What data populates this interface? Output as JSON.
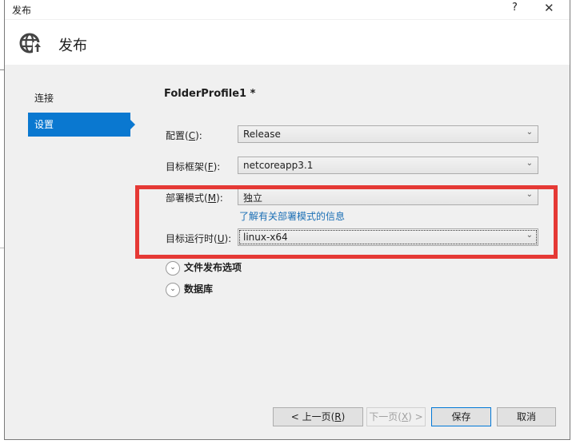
{
  "window": {
    "title": "发布",
    "help_label": "?",
    "close_label": "✕"
  },
  "header": {
    "icon": "globe-publish-icon",
    "title": "发布"
  },
  "nav": {
    "items": [
      {
        "label": "连接",
        "active": false
      },
      {
        "label": "设置",
        "active": true
      }
    ]
  },
  "main": {
    "profile_name": "FolderProfile1 *",
    "fields": {
      "configuration": {
        "label": "配置",
        "accel": "C",
        "value": "Release"
      },
      "target_framework": {
        "label": "目标框架",
        "accel": "F",
        "value": "netcoreapp3.1"
      },
      "deployment_mode": {
        "label": "部署模式",
        "accel": "M",
        "value": "独立"
      },
      "target_runtime": {
        "label": "目标运行时",
        "accel": "U",
        "value": "linux-x64"
      }
    },
    "deployment_link": "了解有关部署模式的信息",
    "expanders": [
      {
        "label": "文件发布选项"
      },
      {
        "label": "数据库"
      }
    ]
  },
  "footer": {
    "prev_label": "< 上一页(",
    "prev_accel": "R",
    "prev_tail": ")",
    "next_label": "下一页(",
    "next_accel": "X",
    "next_tail": ") >",
    "save_label": "保存",
    "cancel_label": "取消"
  },
  "colors": {
    "accent": "#0a78d0",
    "highlight_box": "#e53935",
    "link": "#1b6fb5"
  }
}
